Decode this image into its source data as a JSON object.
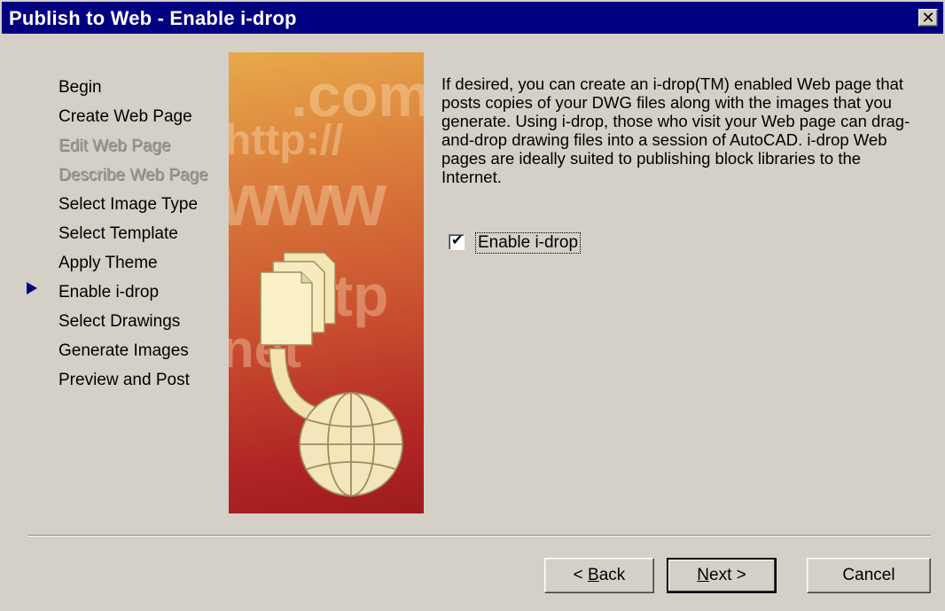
{
  "window": {
    "title": "Publish to Web - Enable i-drop",
    "close_glyph": "✕"
  },
  "steps": [
    {
      "label": "Begin",
      "enabled": true
    },
    {
      "label": "Create Web Page",
      "enabled": true
    },
    {
      "label": "Edit Web Page",
      "enabled": false
    },
    {
      "label": "Describe Web Page",
      "enabled": false
    },
    {
      "label": "Select Image Type",
      "enabled": true
    },
    {
      "label": "Select Template",
      "enabled": true
    },
    {
      "label": "Apply Theme",
      "enabled": true
    },
    {
      "label": "Enable i-drop",
      "enabled": true,
      "current": true
    },
    {
      "label": "Select Drawings",
      "enabled": true
    },
    {
      "label": "Generate Images",
      "enabled": true
    },
    {
      "label": "Preview and Post",
      "enabled": true
    }
  ],
  "art": {
    "watermarks": [
      ".com",
      "http://",
      "www",
      "ftp",
      "net"
    ]
  },
  "description": "If desired, you can create an i-drop(TM) enabled Web page that posts copies of your DWG files along with the images that you generate. Using i-drop, those who visit your Web page can drag-and-drop drawing files into a session of AutoCAD. i-drop Web pages are ideally suited to publishing block libraries to the Internet.",
  "enable_idrop": {
    "label": "Enable i-drop",
    "checked": true
  },
  "buttons": {
    "back_prefix": "< ",
    "back_accel": "B",
    "back_rest": "ack",
    "next_accel": "N",
    "next_rest": "ext >",
    "cancel": "Cancel"
  }
}
